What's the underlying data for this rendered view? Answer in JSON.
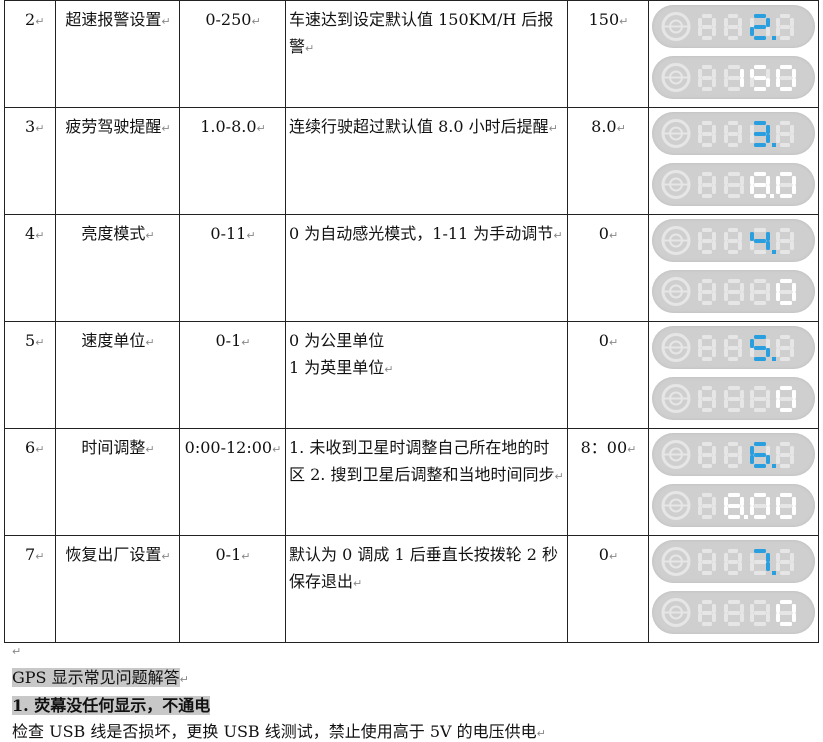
{
  "rows": [
    {
      "num": "2",
      "name": "超速报警设置",
      "range": "0-250",
      "desc": "车速达到设定默认值 150KM/H 后报警",
      "default": "150",
      "code": "2",
      "value": "150"
    },
    {
      "num": "3",
      "name": "疲劳驾驶提醒",
      "range": "1.0-8.0",
      "desc": "连续行驶超过默认值 8.0 小时后提醒",
      "default": "8.0",
      "code": "3",
      "value": "8.0"
    },
    {
      "num": "4",
      "name": "亮度模式",
      "range": "0-11",
      "desc": "0 为自动感光模式，1-11 为手动调节",
      "default": "0",
      "code": "4",
      "value": "0"
    },
    {
      "num": "5",
      "name": "速度单位",
      "range": "0-1",
      "desc": "0 为公里单位\n1 为英里单位",
      "default": "0",
      "code": "5",
      "value": "0"
    },
    {
      "num": "6",
      "name": "时间调整",
      "range": "0:00-12:00",
      "desc": "1. 未收到卫星时调整自己所在地的时区 2. 搜到卫星后调整和当地时间同步",
      "default": "8：00",
      "code": "6",
      "value": "8.00"
    },
    {
      "num": "7",
      "name": "恢复出厂设置",
      "range": "0-1",
      "desc": "默认为 0 调成 1 后垂直长按拨轮 2 秒保存退出",
      "default": "0",
      "code": "7",
      "value": "0"
    }
  ],
  "faq": {
    "title": "GPS 显示常见问题解答",
    "q1": "1. 荧幕没任何显示，不通电",
    "a1": "检查 USB 线是否损坏，更换 USB 线测试，禁止使用高于 5V 的电压供电"
  },
  "colors": {
    "digit_on": "#2a9fe0",
    "digit_ghost": "#e6e6e6",
    "panel": "#cfcfcf"
  },
  "marker": "↵"
}
